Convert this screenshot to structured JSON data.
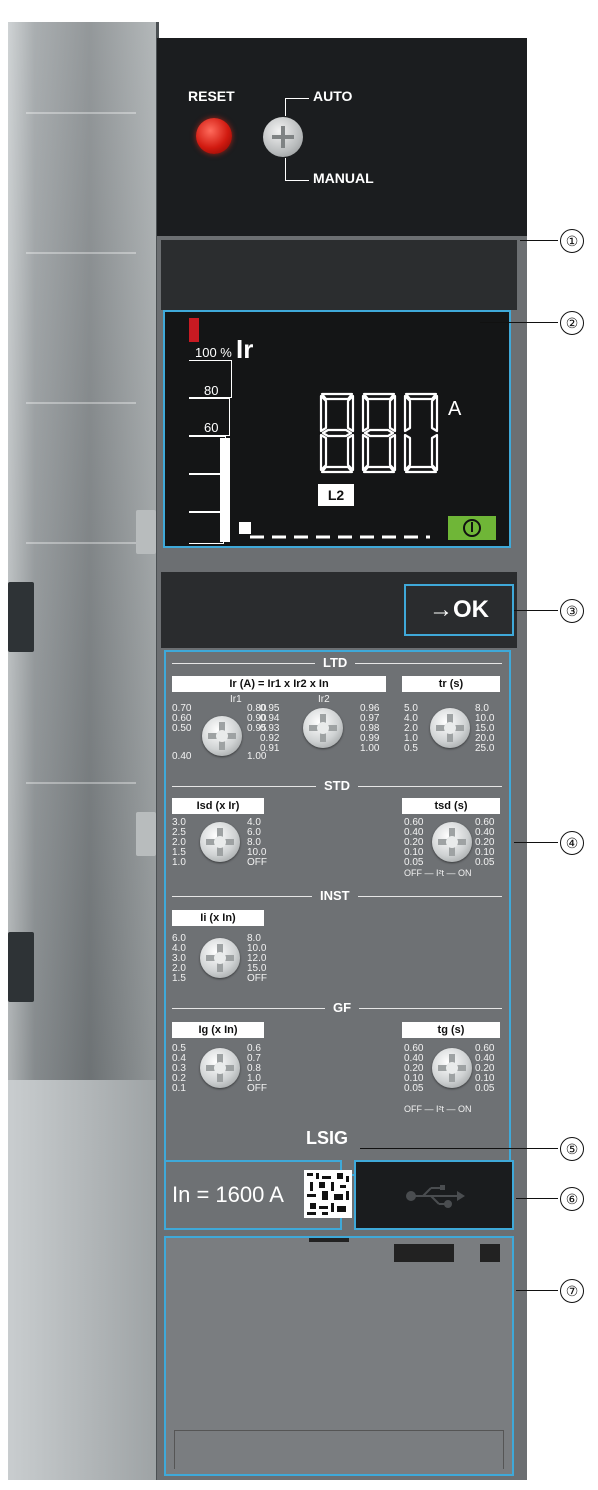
{
  "controls": {
    "reset_label": "RESET",
    "auto_label": "AUTO",
    "manual_label": "MANUAL"
  },
  "display": {
    "percent_label": "100 %",
    "parameter": "Ir",
    "scale_ticks": [
      "80",
      "60"
    ],
    "reading": "880",
    "unit": "A",
    "phase": "L2",
    "status_color": "#6fb637",
    "alarm_color": "#c81a22"
  },
  "ok_button": {
    "arrow": "→",
    "label": "OK"
  },
  "settings": {
    "ltd": {
      "title": "LTD",
      "ir_field": "Ir (A) = Ir1 x Ir2 x In",
      "ir1_label": "Ir1",
      "ir1_left": [
        "0.70",
        "0.60",
        "0.50",
        "0.40"
      ],
      "ir1_right": [
        "0.80",
        "0.90",
        "0.95",
        "1.00"
      ],
      "ir2_label": "Ir2",
      "ir2_left": [
        "0.95",
        "0.94",
        "0.93",
        "0.92",
        "0.91"
      ],
      "ir2_right": [
        "0.96",
        "0.97",
        "0.98",
        "0.99",
        "1.00"
      ],
      "tr_field": "tr (s)",
      "tr_left": [
        "5.0",
        "4.0",
        "2.0",
        "1.0",
        "0.5"
      ],
      "tr_right": [
        "8.0",
        "10.0",
        "15.0",
        "20.0",
        "25.0"
      ]
    },
    "std": {
      "title": "STD",
      "isd_field": "Isd (x Ir)",
      "isd_left": [
        "3.0",
        "2.5",
        "2.0",
        "1.5",
        "1.0"
      ],
      "isd_right": [
        "4.0",
        "6.0",
        "8.0",
        "10.0",
        "OFF"
      ],
      "tsd_field": "tsd (s)",
      "tsd_left": [
        "0.60",
        "0.40",
        "0.20",
        "0.10",
        "0.05"
      ],
      "tsd_right": [
        "0.60",
        "0.40",
        "0.20",
        "0.10",
        "0.05"
      ],
      "i2t_line": "OFF — I²t — ON"
    },
    "inst": {
      "title": "INST",
      "ii_field": "Ii (x In)",
      "ii_left": [
        "6.0",
        "4.0",
        "3.0",
        "2.0",
        "1.5"
      ],
      "ii_right": [
        "8.0",
        "10.0",
        "12.0",
        "15.0",
        "OFF"
      ]
    },
    "gf": {
      "title": "GF",
      "ig_field": "Ig (x In)",
      "ig_left": [
        "0.5",
        "0.4",
        "0.3",
        "0.2",
        "0.1"
      ],
      "ig_right": [
        "0.6",
        "0.7",
        "0.8",
        "1.0",
        "OFF"
      ],
      "tg_field": "tg (s)",
      "tg_left": [
        "0.60",
        "0.40",
        "0.20",
        "0.10",
        "0.05"
      ],
      "tg_right": [
        "0.60",
        "0.40",
        "0.20",
        "0.10",
        "0.05"
      ],
      "i2t_line": "OFF — I²t — ON"
    }
  },
  "model": "LSIG",
  "rating": "In = 1600 A",
  "callouts": [
    "①",
    "②",
    "③",
    "④",
    "⑤",
    "⑥",
    "⑦"
  ],
  "accent_color": "#3fa9d9"
}
